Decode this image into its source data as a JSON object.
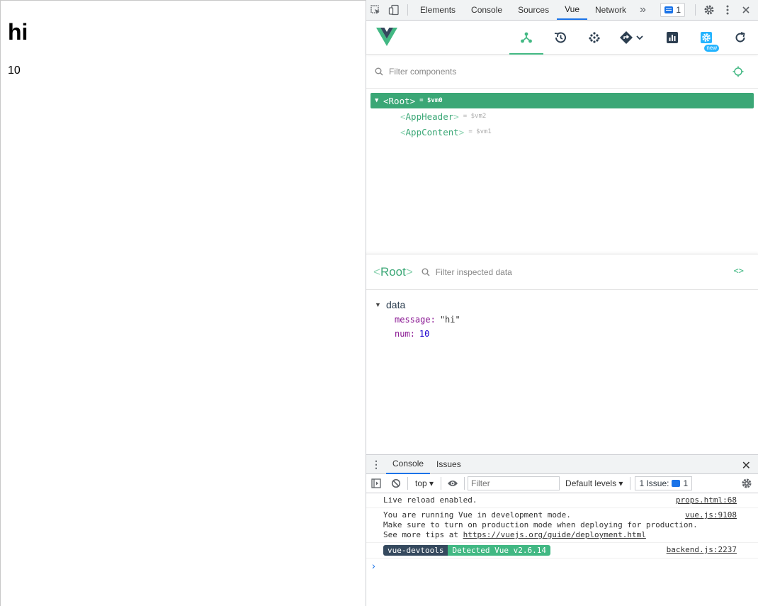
{
  "page": {
    "heading": "hi",
    "num": "10"
  },
  "devtools": {
    "tabs": [
      "Elements",
      "Console",
      "Sources",
      "Vue",
      "Network"
    ],
    "active_tab": "Vue",
    "more_tabs": "»",
    "issues_count": "1"
  },
  "vue": {
    "toolbar_new_badge": "new",
    "filter_placeholder": "Filter components",
    "tree": {
      "root": {
        "open": "<",
        "name": "Root",
        "close": ">",
        "vm": "= $vm0"
      },
      "children": [
        {
          "open": "<",
          "name": "AppHeader",
          "close": ">",
          "vm": "= $vm2"
        },
        {
          "open": "<",
          "name": "AppContent",
          "close": ">",
          "vm": "= $vm1"
        }
      ]
    },
    "inspector": {
      "title_open": "<",
      "title_name": "Root",
      "title_close": ">",
      "filter_placeholder": "Filter inspected data",
      "code_icon": "<>",
      "section": "data",
      "props": [
        {
          "key": "message",
          "value": "\"hi\""
        },
        {
          "key": "num",
          "value": "10"
        }
      ]
    }
  },
  "console": {
    "tabs": [
      "Console",
      "Issues"
    ],
    "active_tab": "Console",
    "context": "top",
    "filter_placeholder": "Filter",
    "levels": "Default levels",
    "issue_label": "1 Issue:",
    "issue_count": "1",
    "logs": [
      {
        "lines": [
          "Live reload enabled."
        ],
        "source": "props.html:68"
      },
      {
        "lines": [
          "You are running Vue in development mode.",
          "Make sure to turn on production mode when deploying for production.",
          "See more tips at "
        ],
        "link": "https://vuejs.org/guide/deployment.html",
        "source": "vue.js:9108"
      },
      {
        "tag1": "vue-devtools",
        "tag2": "Detected Vue v2.6.14",
        "source": "backend.js:2237"
      }
    ],
    "prompt": "›"
  },
  "colors": {
    "vue_green": "#42b883",
    "vue_dark": "#35495e",
    "selected_row": "#3ba776",
    "devtools_blue": "#1a73e8"
  },
  "icons": {
    "tabbar": [
      "inspect-element-icon",
      "device-toolbar-icon",
      "gear-icon",
      "kebab-menu-icon"
    ],
    "vue_toolbar": [
      "components-tree-icon",
      "timeline-history-icon",
      "plugins-dots-icon",
      "router-diamond-icon",
      "performance-chart-icon",
      "settings-gear-icon",
      "refresh-icon"
    ]
  }
}
